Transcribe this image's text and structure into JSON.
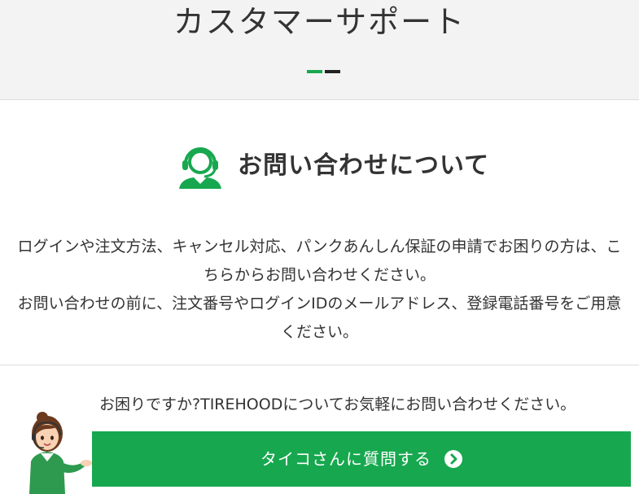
{
  "header": {
    "title": "カスタマーサポート",
    "accent_colors": [
      "#17a84f",
      "#222222"
    ]
  },
  "inquiry": {
    "icon": "headset-support-icon",
    "heading": "お問い合わせについて",
    "description_lines": [
      "ログインや注文方法、キャンセル対応、パンクあんしん保証の申請でお困りの方は、こちらからお問い合わせください。",
      "お問い合わせの前に、注文番号やログインIDのメールアドレス、登録電話番号をご用意ください。"
    ]
  },
  "help": {
    "question": "お困りですか?TIREHOODについてお気軽にお問い合わせください。",
    "mascot": "taiko-mascot-illustration",
    "button_label": "タイコさんに質問する",
    "button_icon": "chevron-right-circle-icon",
    "button_color": "#17a84f"
  }
}
